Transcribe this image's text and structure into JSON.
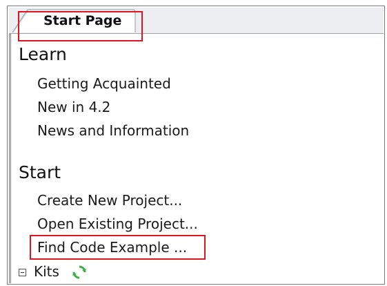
{
  "tab": {
    "label": "Start Page"
  },
  "learn": {
    "heading": "Learn",
    "items": [
      "Getting Acquainted",
      "New in 4.2",
      "News and Information"
    ]
  },
  "start": {
    "heading": "Start",
    "items": [
      "Create New Project...",
      "Open Existing Project...",
      "Find Code Example ..."
    ]
  },
  "kits": {
    "label": "Kits",
    "expander_icon": "collapse-minus-icon",
    "refresh_icon": "refresh-icon"
  },
  "colors": {
    "highlight": "#e0141e",
    "refresh_green": "#3cb043"
  }
}
